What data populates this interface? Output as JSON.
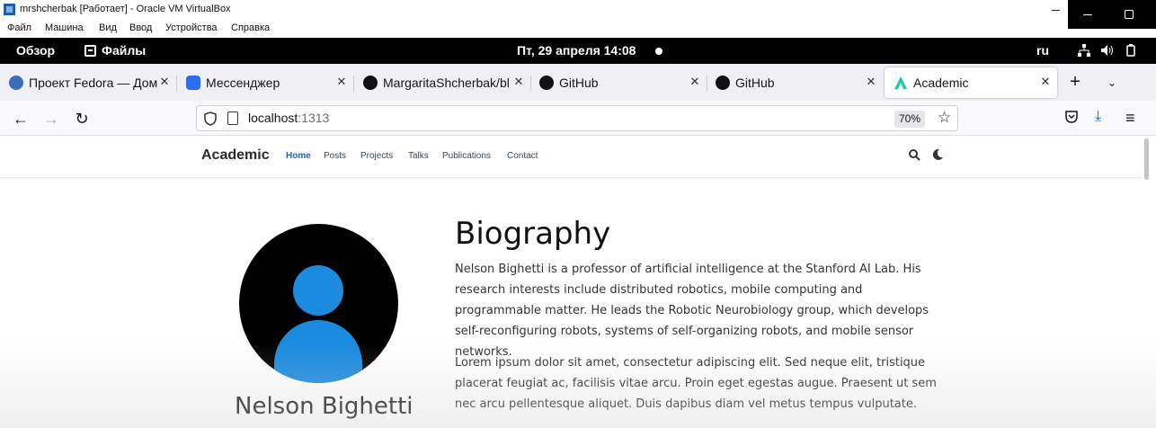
{
  "vbox": {
    "title": "mrshcherbak [Работает] - Oracle VM VirtualBox",
    "menu": [
      "Файл",
      "Машина",
      "Вид",
      "Ввод",
      "Устройства",
      "Справка"
    ]
  },
  "gnome": {
    "overview": "Обзор",
    "files": "Файлы",
    "clock": "Пт, 29 апреля  14:08",
    "language": "ru"
  },
  "tabs": [
    {
      "title": "Проект Fedora — Дом",
      "favicon": "fedora-icon",
      "color": "#3c6eb4"
    },
    {
      "title": "Мессенджер",
      "favicon": "messenger-icon",
      "color": "#2a6ef5"
    },
    {
      "title": "MargaritaShcherbak/bl",
      "favicon": "github-icon",
      "color": "#111111"
    },
    {
      "title": "GitHub",
      "favicon": "github-icon",
      "color": "#111111"
    },
    {
      "title": "GitHub",
      "favicon": "github-icon",
      "color": "#111111"
    },
    {
      "title": "Academic",
      "favicon": "academic-icon",
      "color": "#1ec9a6",
      "active": true
    }
  ],
  "urlbar": {
    "host": "localhost",
    "port": ":1313",
    "zoom": "70%"
  },
  "site": {
    "brand": "Academic",
    "nav": [
      "Home",
      "Posts",
      "Projects",
      "Talks",
      "Publications",
      "Contact"
    ],
    "active_nav": "Home"
  },
  "profile": {
    "name": "Nelson Bighetti"
  },
  "biography": {
    "heading": "Biography",
    "paragraphs": [
      "Nelson Bighetti is a professor of artificial intelligence at the Stanford AI Lab. His research interests include distributed robotics, mobile computing and programmable matter. He leads the Robotic Neurobiology group, which develops self-reconfiguring robots, systems of self-organizing robots, and mobile sensor networks.",
      "Lorem ipsum dolor sit amet, consectetur adipiscing elit. Sed neque elit, tristique placerat feugiat ac, facilisis vitae arcu. Proin eget egestas augue. Praesent ut sem nec arcu pellentesque aliquet. Duis dapibus diam vel metus tempus vulputate."
    ]
  },
  "colors": {
    "link_active": "#1565c0",
    "avatar_fill": "#1b8be0",
    "download_accent": "#0060df"
  }
}
